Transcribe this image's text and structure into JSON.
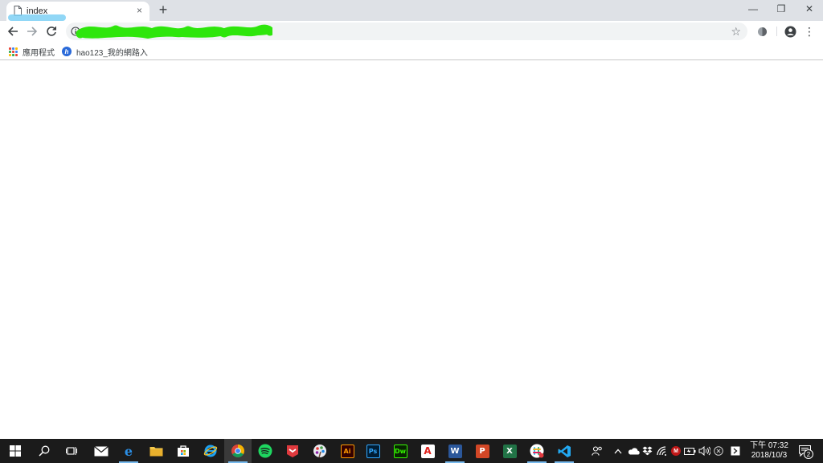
{
  "browser": {
    "tab": {
      "title": "index",
      "close": "×"
    },
    "new_tab": "+",
    "window_controls": {
      "minimize": "—",
      "restore": "❐",
      "close": "✕"
    },
    "toolbar": {
      "back_icon": "arrow-left-icon",
      "forward_icon": "arrow-right-icon",
      "reload_icon": "reload-icon",
      "url": "",
      "bookmark_star": "☆",
      "extension_icon": "extension-icon",
      "profile_icon": "account-icon",
      "menu": "⋮"
    },
    "bookmarks": [
      {
        "label": "應用程式",
        "icon": "apps-grid-icon"
      },
      {
        "label": "hao123_我的網路入",
        "icon": "hao123-icon"
      }
    ]
  },
  "taskbar": {
    "pinned": [
      {
        "name": "start",
        "icon": "windows-icon"
      },
      {
        "name": "search",
        "icon": "search-icon"
      },
      {
        "name": "task-view",
        "icon": "task-view-icon"
      },
      {
        "name": "mail",
        "icon": "mail-icon"
      },
      {
        "name": "edge",
        "icon": "edge-icon",
        "running": true
      },
      {
        "name": "file-explorer",
        "icon": "folder-icon"
      },
      {
        "name": "store",
        "icon": "store-icon"
      },
      {
        "name": "internet-explorer",
        "icon": "ie-icon"
      },
      {
        "name": "chrome",
        "icon": "chrome-icon",
        "running": true,
        "active": true
      },
      {
        "name": "spotify",
        "icon": "spotify-icon"
      },
      {
        "name": "red-app",
        "icon": "red-app-icon"
      },
      {
        "name": "paint",
        "icon": "palette-icon"
      },
      {
        "name": "illustrator",
        "label": "Ai"
      },
      {
        "name": "photoshop",
        "label": "Ps"
      },
      {
        "name": "dreamweaver",
        "label": "Dw"
      },
      {
        "name": "acrobat",
        "label": "A"
      },
      {
        "name": "word",
        "label": "W",
        "running": true
      },
      {
        "name": "powerpoint",
        "label": "P"
      },
      {
        "name": "excel",
        "label": "X"
      },
      {
        "name": "slack",
        "icon": "slack-icon",
        "running": true
      },
      {
        "name": "vscode",
        "icon": "vscode-icon",
        "running": true
      }
    ],
    "tray": [
      "people-icon",
      "chevron-up-icon",
      "onedrive-icon",
      "dropbox-icon",
      "wifi-icon",
      "mcafee-icon",
      "battery-icon",
      "volume-icon",
      "cancel-icon",
      "action-icon"
    ],
    "clock": {
      "time": "下午 07:32",
      "date": "2018/10/3"
    },
    "notification_count": "2"
  },
  "colors": {
    "tabstrip": "#dee1e6",
    "taskbar": "#1b1b1b",
    "accent": "#76b9ed",
    "scribble": "#2ee60c",
    "tab_highlight": "#7ed0f4"
  }
}
